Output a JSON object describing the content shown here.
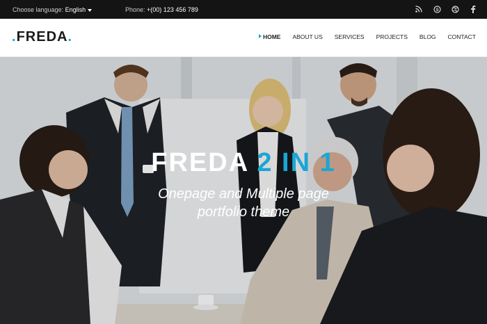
{
  "topbar": {
    "language_label": "Choose language:",
    "language_value": "English",
    "phone_label": "Phone:",
    "phone_value": "+(00) 123 456 789",
    "social_icons": [
      "rss-icon",
      "skype-icon",
      "dribbble-icon",
      "facebook-icon"
    ]
  },
  "brand": {
    "name": "FREDA",
    "accent_color": "#1aa6d6"
  },
  "nav": {
    "items": [
      {
        "label": "HOME",
        "active": true
      },
      {
        "label": "ABOUT US",
        "active": false
      },
      {
        "label": "SERVICES",
        "active": false
      },
      {
        "label": "PROJECTS",
        "active": false
      },
      {
        "label": "BLOG",
        "active": false
      },
      {
        "label": "CONTACT",
        "active": false
      }
    ]
  },
  "hero": {
    "title_main": "FREDA",
    "title_accent": "2 IN 1",
    "subtitle_line1": "Onepage and Multiple page",
    "subtitle_line2": "portfolio theme"
  }
}
